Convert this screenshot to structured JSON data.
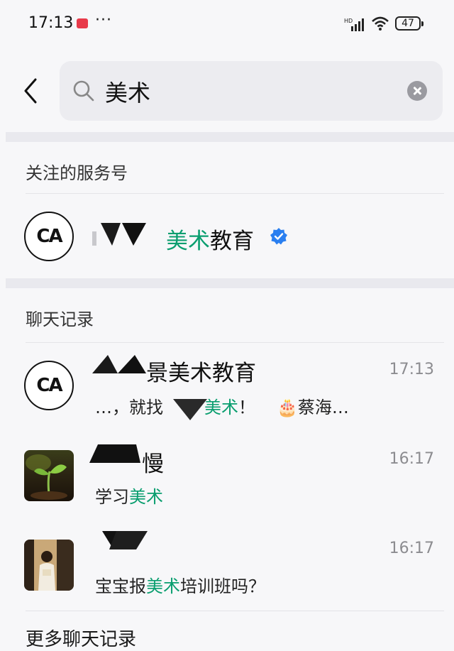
{
  "status_bar": {
    "time": "17:13",
    "more": "···",
    "battery": "47"
  },
  "search": {
    "query": "美术"
  },
  "sections": {
    "followed_title": "关注的服务号",
    "chats_title": "聊天记录",
    "more_chats": "更多聊天记录"
  },
  "service_account": {
    "avatar_text": "CA",
    "name_highlight": "美术",
    "name_rest": "教育",
    "verified": true
  },
  "chats": [
    {
      "avatar_text": "CA",
      "name_prefix": "景",
      "name_highlight": "美术",
      "name_rest": "教育",
      "time": "17:13",
      "msg_part1": "…，就找",
      "msg_highlight": "美术",
      "msg_part2": "！",
      "msg_emoji": "🎂",
      "msg_part3": "蔡海…"
    },
    {
      "name_suffix": "慢",
      "time": "16:17",
      "msg_part1": "学习",
      "msg_highlight": "美术",
      "msg_part2": ""
    },
    {
      "time": "16:17",
      "msg_part1": "宝宝报",
      "msg_highlight": "美术",
      "msg_part2": "培训班吗？"
    }
  ],
  "colors": {
    "highlight": "#0a9e6f",
    "verified": "#2a7ff0",
    "background": "#f7f7f9"
  }
}
